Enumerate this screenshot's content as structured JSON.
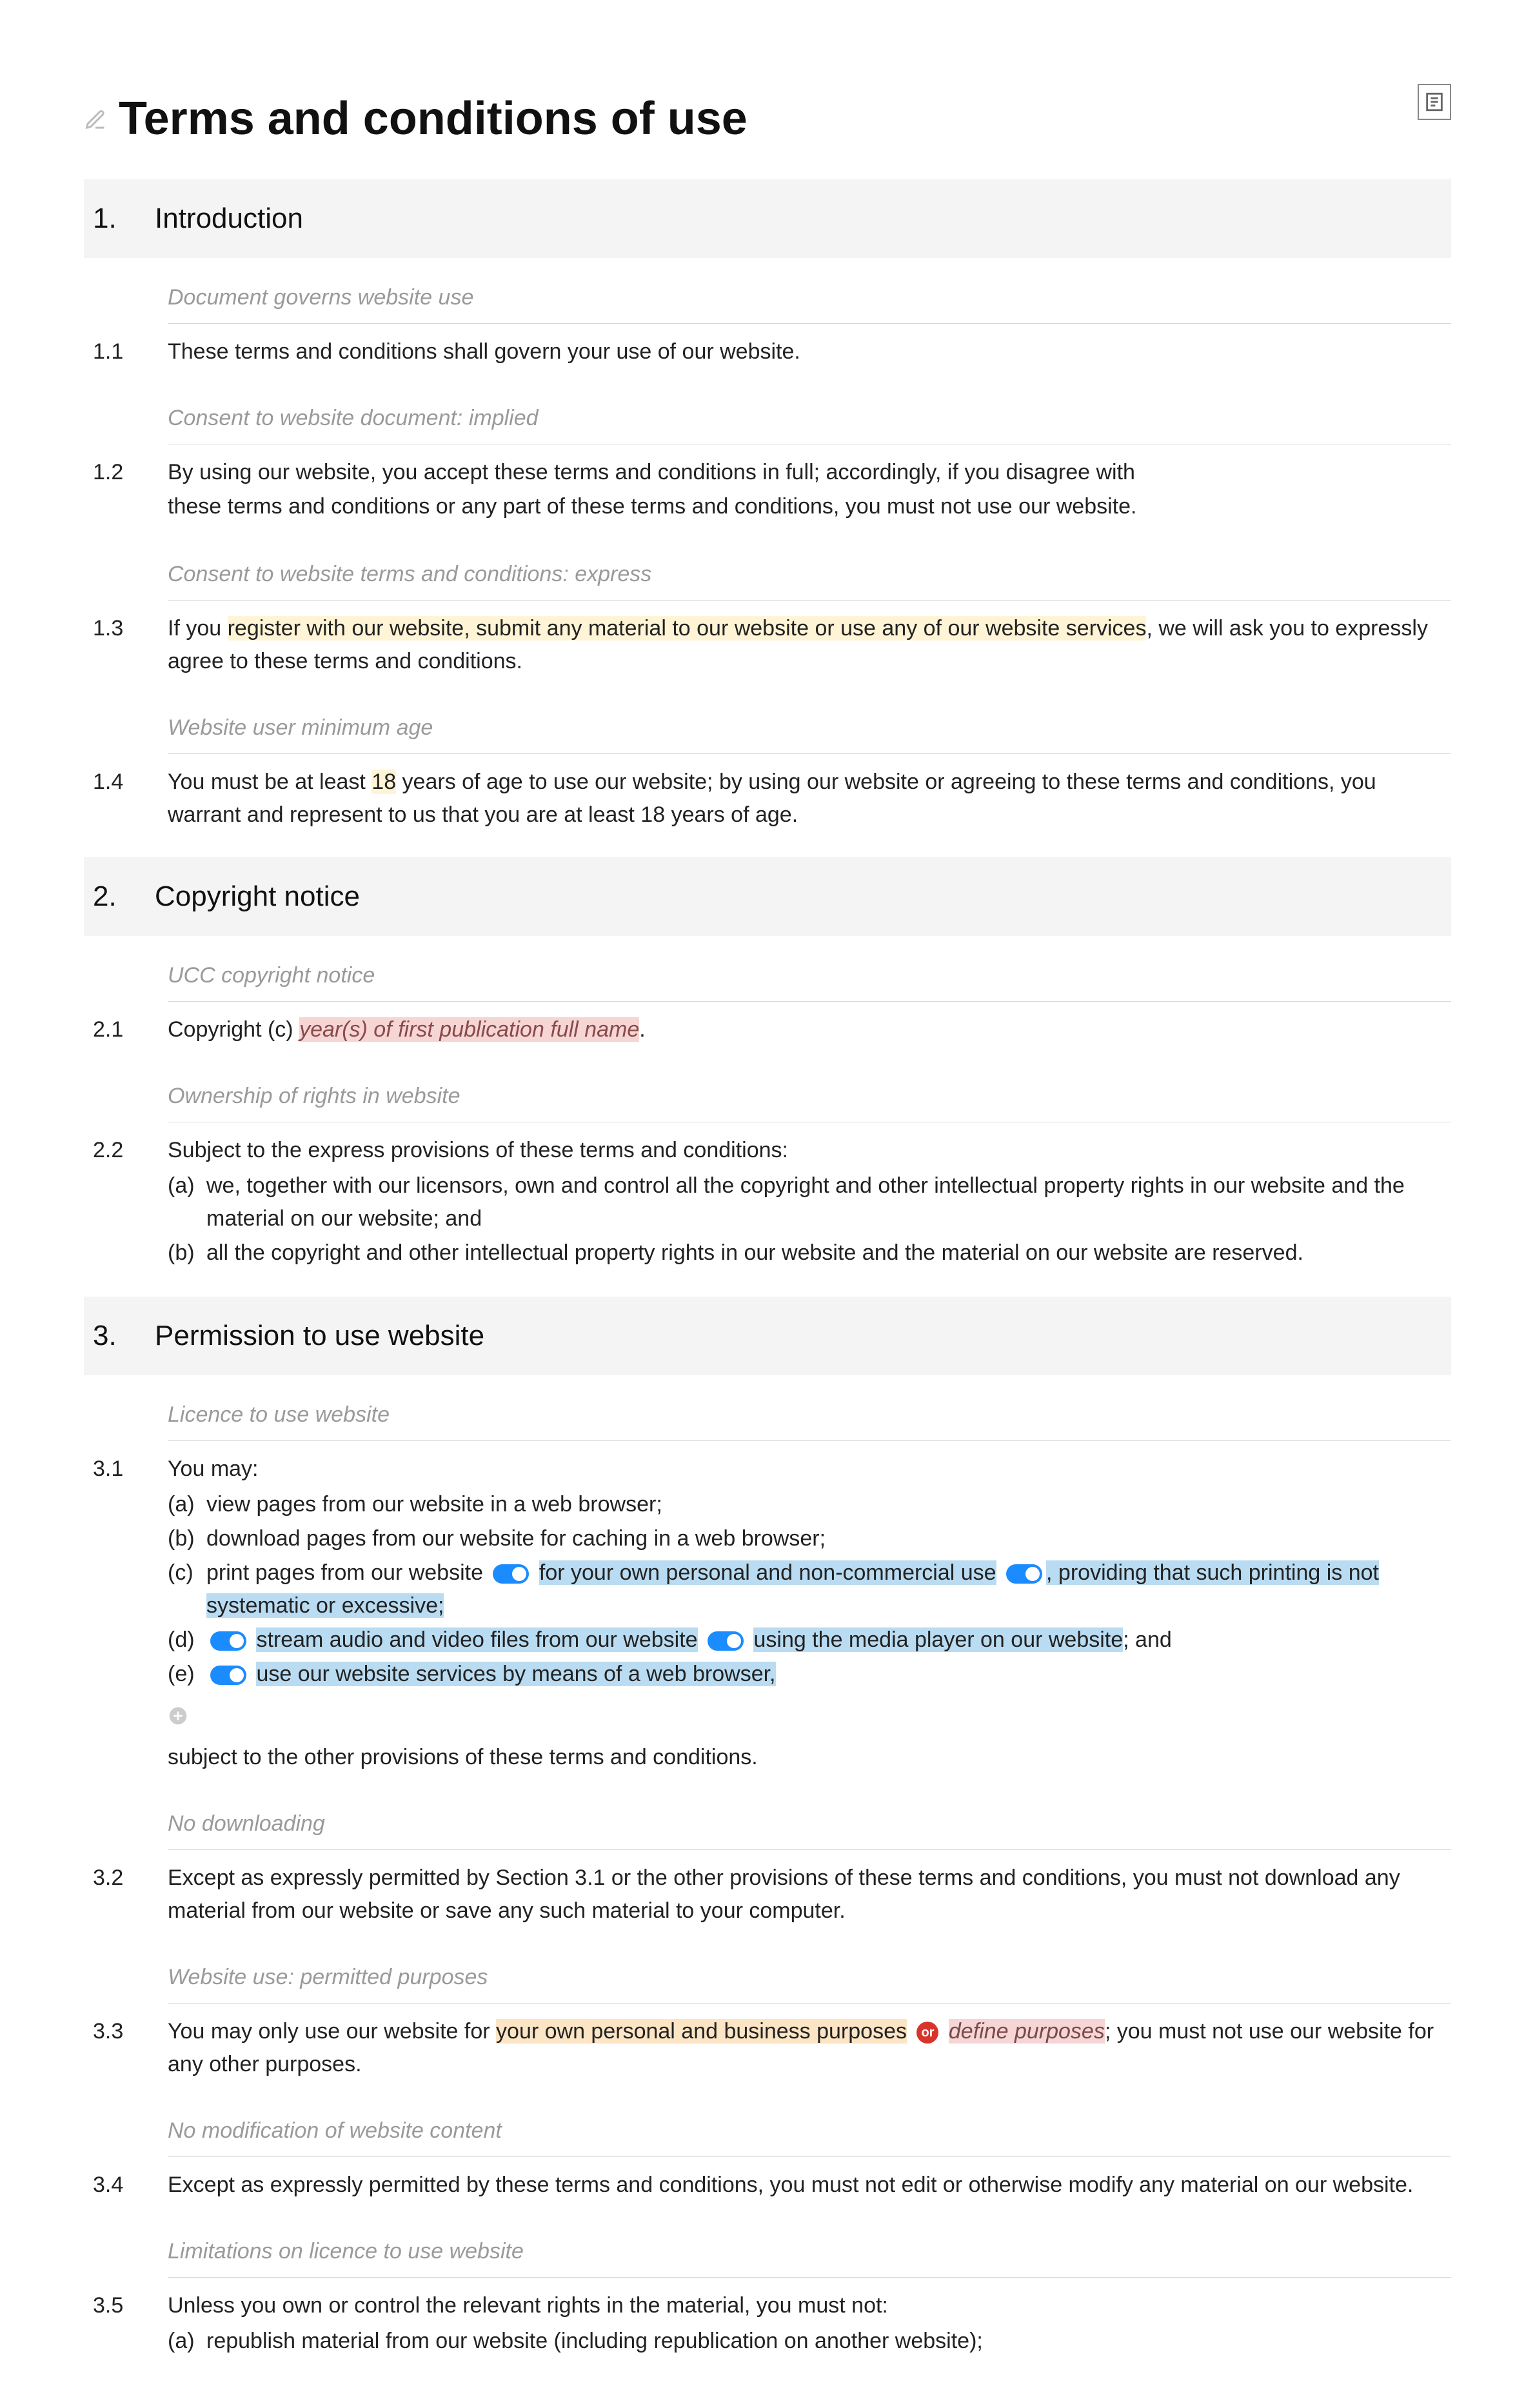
{
  "title": "Terms and conditions of use",
  "sections": [
    {
      "num": "1.",
      "title": "Introduction",
      "clauses": [
        {
          "hint": "Document governs website use",
          "num": "1.1",
          "body": "These terms and conditions shall govern your use of our website."
        },
        {
          "hint": "Consent to website document: implied",
          "num": "1.2",
          "body_lines": [
            "By using our website, you accept these terms and conditions in full; accordingly, if you disagree with",
            "these terms and conditions or any part of these terms and conditions, you must not use our website."
          ]
        },
        {
          "hint": "Consent to website terms and conditions: express",
          "num": "1.3",
          "pre": "If you ",
          "hl": "register with our website, submit any material to our website or use any of our website services",
          "post": ", we will ask you to expressly agree to these terms and conditions."
        },
        {
          "hint": "Website user minimum age",
          "num": "1.4",
          "parts": [
            "You must be at least ",
            "18",
            " years of age to use our website; by using our website or agreeing to these terms and conditions, you warrant and represent to us that you are at least 18 years of age."
          ]
        }
      ]
    },
    {
      "num": "2.",
      "title": "Copyright notice",
      "clauses": [
        {
          "hint": "UCC copyright notice",
          "num": "2.1",
          "pre": "Copyright (c) ",
          "placeholder": "year(s) of first publication full name",
          "post": "."
        },
        {
          "hint": "Ownership of rights in website",
          "num": "2.2",
          "intro": "Subject to the express provisions of these terms and conditions:",
          "subs": [
            {
              "letter": "(a)",
              "text": "we, together with our licensors, own and control all the copyright and other intellectual property rights in our website and the material on our website; and"
            },
            {
              "letter": "(b)",
              "text": "all the copyright and other intellectual property rights in our website and the material on our website are reserved."
            }
          ]
        }
      ]
    },
    {
      "num": "3.",
      "title": "Permission to use website",
      "clauses": [
        {
          "hint": "Licence to use website",
          "num": "3.1",
          "intro": "You may:",
          "subs": [
            {
              "letter": "(a)",
              "text": "view pages from our website in a web browser;"
            },
            {
              "letter": "(b)",
              "text": "download pages from our website for caching in a web browser;"
            },
            {
              "letter": "(c)",
              "c_pre": "print pages from our website",
              "c_mid1": " for your own personal and non-commercial use",
              "c_mid2": ", providing that such printing is not systematic or excessive;"
            },
            {
              "letter": "(d)",
              "d_part1": "stream audio and video files from our website",
              "d_part2": " using the media player on our website",
              "d_post": "; and"
            },
            {
              "letter": "(e)",
              "e_text": "use our website services by means of a web browser,"
            }
          ],
          "tail": "subject to the other provisions of these terms and conditions."
        },
        {
          "hint": "No downloading",
          "num": "3.2",
          "body": "Except as expressly permitted by Section 3.1 or the other provisions of these terms and conditions, you must not download any material from our website or save any such material to your computer."
        },
        {
          "hint": "Website use: permitted purposes",
          "num": "3.3",
          "pre": "You may only use our website for ",
          "hl_orange": "your own personal and business purposes",
          "or": "or",
          "hl_pink": "define purposes",
          "post": "; you must not use our website for any other purposes."
        },
        {
          "hint": "No modification of website content",
          "num": "3.4",
          "body": "Except as expressly permitted by these terms and conditions, you must not edit or otherwise modify any material on our website."
        },
        {
          "hint": "Limitations on licence to use website",
          "num": "3.5",
          "intro": "Unless you own or control the relevant rights in the material, you must not:",
          "subs": [
            {
              "letter": "(a)",
              "text": "republish material from our website (including republication on another website);"
            }
          ]
        }
      ]
    }
  ]
}
